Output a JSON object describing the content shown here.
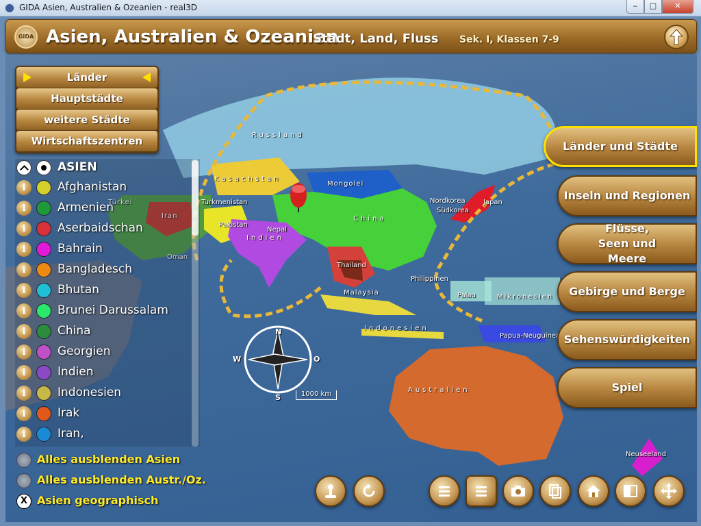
{
  "window": {
    "title": "GIDA Asien, Australien & Ozeanien - real3D",
    "min_label": "‒",
    "max_label": "□",
    "close_label": "✕"
  },
  "header": {
    "logo": "GIDA",
    "title": "Asien, Australien & Ozeanien",
    "subtitle": "Stadt, Land, Fluss",
    "level": "Sek. I, Klassen 7-9"
  },
  "menu": {
    "items": [
      {
        "label": "Länder"
      },
      {
        "label": "Hauptstädte"
      },
      {
        "label": "weitere Städte"
      },
      {
        "label": "Wirtschaftszentren"
      }
    ]
  },
  "list": {
    "header": "ASIEN",
    "info_glyph": "i",
    "countries": [
      {
        "name": "Afghanistan",
        "color": "#d4cf2a"
      },
      {
        "name": "Armenien",
        "color": "#1f9a3a"
      },
      {
        "name": "Aserbaidschan",
        "color": "#d8313a"
      },
      {
        "name": "Bahrain",
        "color": "#e01ad8"
      },
      {
        "name": "Bangladesch",
        "color": "#ee8a14"
      },
      {
        "name": "Bhutan",
        "color": "#1fc0d6"
      },
      {
        "name": "Brunei Darussalam",
        "color": "#2ae86a"
      },
      {
        "name": "China",
        "color": "#2a8c3c"
      },
      {
        "name": "Georgien",
        "color": "#c050c8"
      },
      {
        "name": "Indien",
        "color": "#8a4ac6"
      },
      {
        "name": "Indonesien",
        "color": "#c8b848"
      },
      {
        "name": "Irak",
        "color": "#e0581a"
      },
      {
        "name": "Iran,",
        "color": "#1a8ad6"
      }
    ]
  },
  "options": {
    "hide_asia": "Alles ausblenden Asien",
    "hide_aus": "Alles ausblenden Austr./Oz.",
    "geo": "Asien geographisch",
    "geo_glyph": "X"
  },
  "right_menu": {
    "items": [
      {
        "label": "Länder und Städte"
      },
      {
        "label": "Inseln und Regionen"
      },
      {
        "label": "Flüsse, Seen und Meere"
      },
      {
        "label": "Gebirge und Berge"
      },
      {
        "label": "Sehenswürdigkeiten"
      },
      {
        "label": "Spiel"
      }
    ]
  },
  "map": {
    "compass": {
      "n": "N",
      "s": "S",
      "w": "W",
      "o": "O"
    },
    "scale": "1000 km",
    "labels": {
      "russland": "Russland",
      "kasachstan": "Kasachstan",
      "mongolei": "Mongolei",
      "china": "China",
      "indien": "Indien",
      "pakistan": "Pakistan",
      "iran": "Iran",
      "tuerkei": "Türkei",
      "thailand": "Thailand",
      "japan": "Japan",
      "nordkorea": "Nordkorea",
      "suedkorea": "Südkorea",
      "australien": "Australien",
      "neuseeland": "Neuseeland",
      "indonesien": "Indonesien",
      "mikronesien": "Mikronesien",
      "palau": "Palau",
      "papua": "Papua-Neuguinea",
      "malaysia": "Malaysia",
      "philippinen": "Philippinen",
      "turkmenistan": "Turkmenistan",
      "nepal": "Nepal",
      "oman": "Oman"
    }
  },
  "colors": {
    "gold": "#b5843e",
    "highlight": "#ffe000",
    "option_text": "#ffea2a"
  }
}
